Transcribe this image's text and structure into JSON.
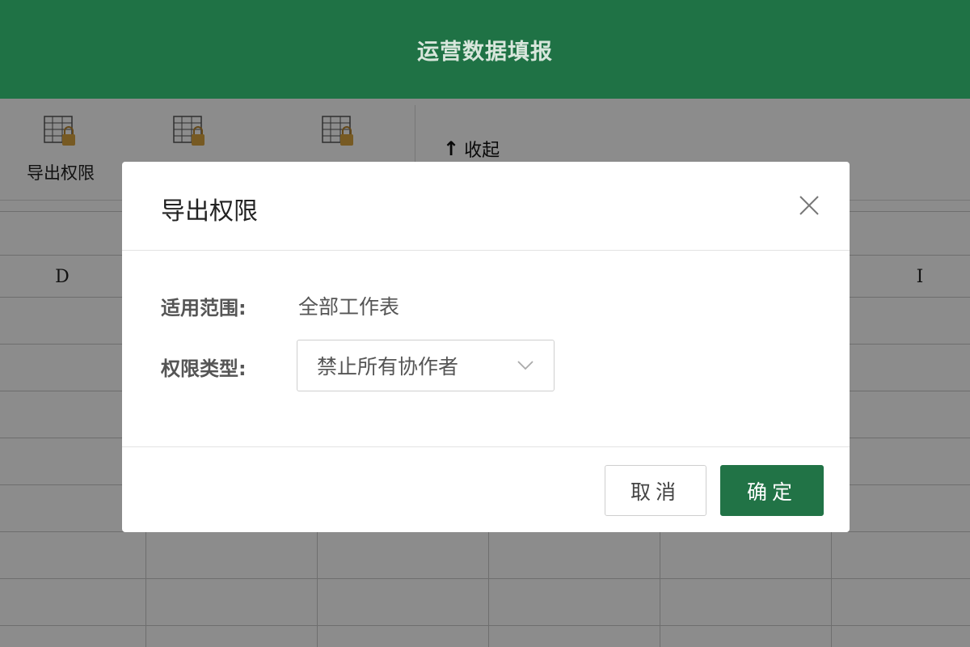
{
  "header": {
    "title": "运营数据填报"
  },
  "toolbar": {
    "tools": [
      {
        "label": "导出权限",
        "icon": "sheet-lock-icon"
      },
      {
        "label": "",
        "icon": "sheet-lock-icon"
      },
      {
        "label": "",
        "icon": "sheet-lock-icon"
      }
    ],
    "collapse_label": "收起",
    "collapse_icon": "arrow-up-icon"
  },
  "sheet": {
    "columns": [
      "D",
      "I"
    ]
  },
  "modal": {
    "title": "导出权限",
    "close_icon": "close-icon",
    "scope_label": "适用范围:",
    "scope_value": "全部工作表",
    "type_label": "权限类型:",
    "type_value": "禁止所有协作者",
    "cancel_label": "取消",
    "confirm_label": "确定"
  },
  "colors": {
    "header_bg": "#1f7245",
    "primary_button": "#217346",
    "overlay": "rgba(0,0,0,0.45)"
  }
}
